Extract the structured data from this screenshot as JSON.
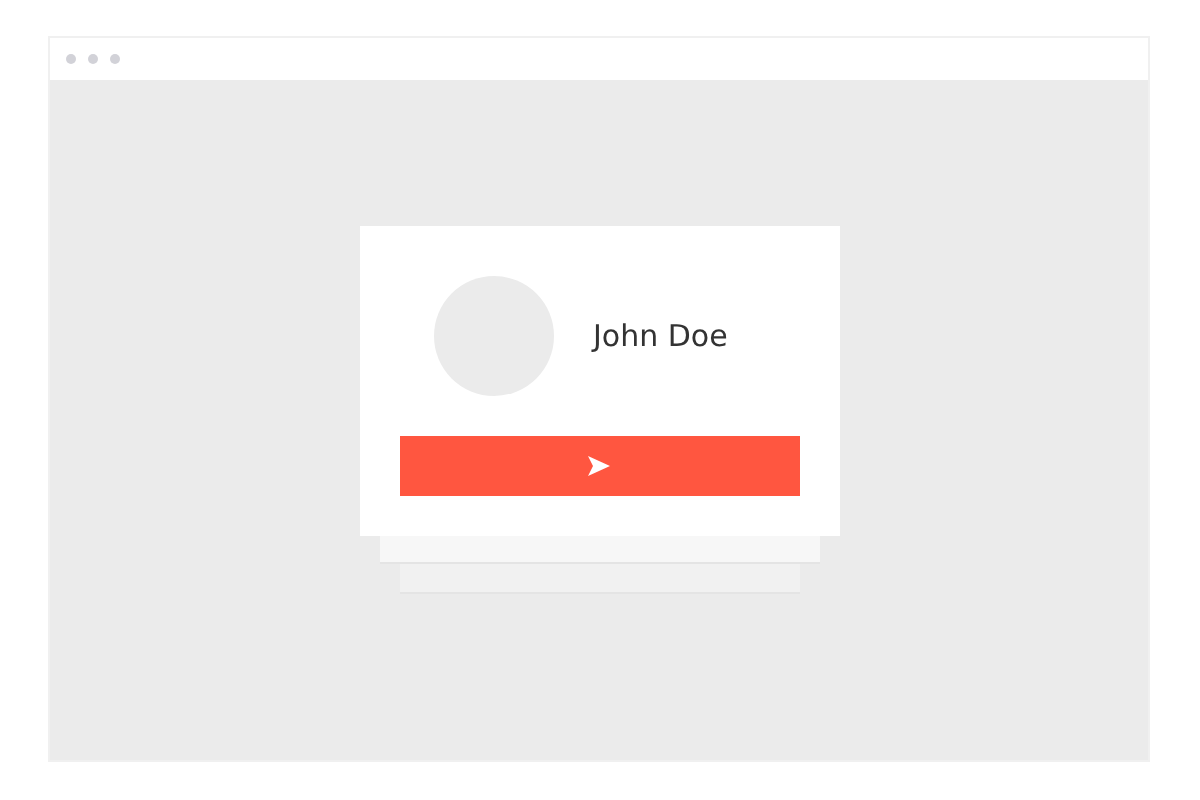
{
  "profile": {
    "name": "John Doe"
  }
}
